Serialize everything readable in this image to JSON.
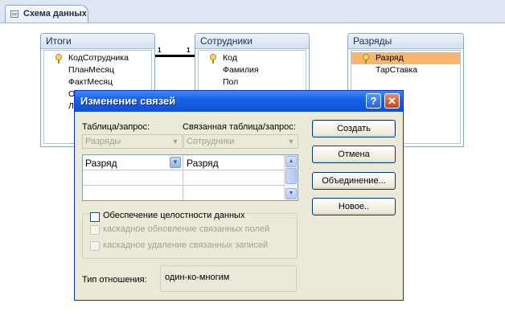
{
  "tab": {
    "label": "Схема данных"
  },
  "tables": [
    {
      "title": "Итоги",
      "fields": [
        "КодСотрудника",
        "ПланМесяц",
        "ФактМесяц",
        "О",
        "Л"
      ],
      "key_field": 0
    },
    {
      "title": "Сотрудники",
      "fields": [
        "Код",
        "Фамилия",
        "Пол"
      ],
      "key_field": 0
    },
    {
      "title": "Разряды",
      "fields": [
        "Разряд",
        "ТарСтавка"
      ],
      "key_field": 0,
      "selected_field": 0
    }
  ],
  "relation": {
    "left_mark": "1",
    "right_mark": "1"
  },
  "dialog": {
    "title": "Изменение связей",
    "help_button": "?",
    "close_button": "✕",
    "table_label": "Таблица/запрос:",
    "related_table_label": "Связанная таблица/запрос:",
    "table_value": "Разряды",
    "related_table_value": "Сотрудники",
    "grid": {
      "left_field": "Разряд",
      "right_field": "Разряд"
    },
    "integrity_label": "Обеспечение целостности данных",
    "integrity_checked": false,
    "cascade_update_label": "каскадное обновление связанных полей",
    "cascade_delete_label": "каскадное удаление связанных записей",
    "relation_type_label": "Тип отношения:",
    "relation_type_value": "один-ко-многим",
    "buttons": {
      "create": "Создать",
      "cancel": "Отмена",
      "join": "Объединение...",
      "new": "Новое.."
    }
  }
}
